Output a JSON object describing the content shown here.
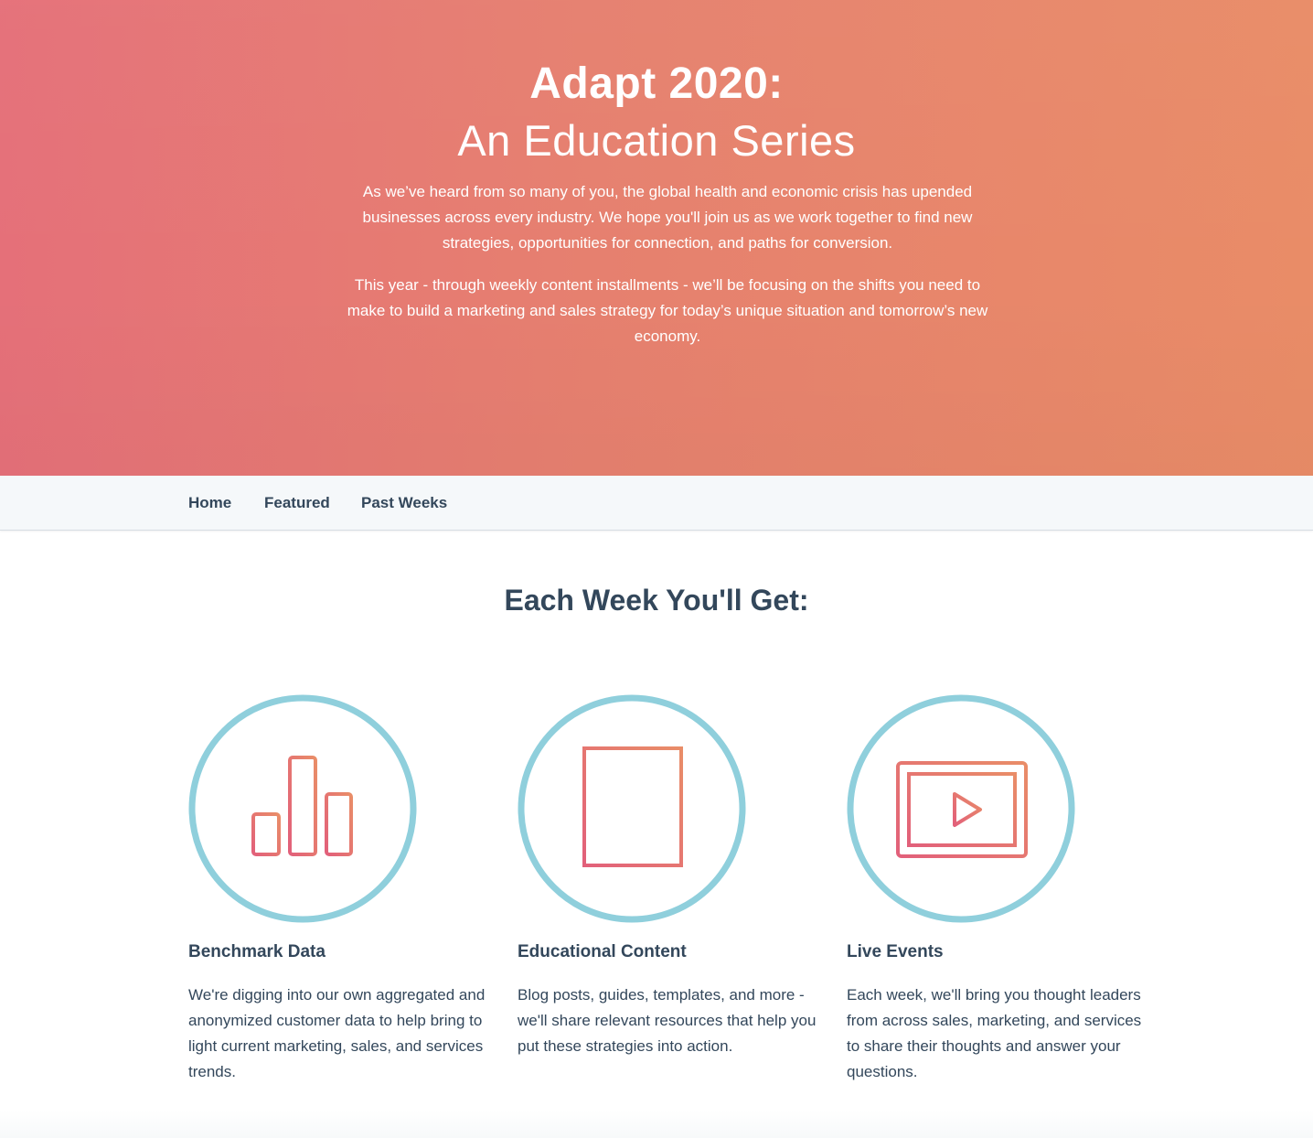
{
  "hero": {
    "title": "Adapt 2020:",
    "subtitle": "An Education Series",
    "paragraph_1": "As we’ve heard from so many of you, the global health and economic crisis has upended businesses across every industry. We hope you'll join us as we work together to find new strategies, opportunities for connection, and paths for conversion.",
    "paragraph_2": "This year - through weekly content installments - we’ll be focusing on the shifts you need to make to build a marketing and sales strategy for today’s unique situation and tomorrow’s new economy.",
    "gradient_start": "#e57079",
    "gradient_end": "#e98c67"
  },
  "nav": {
    "items": [
      {
        "label": "Home"
      },
      {
        "label": "Featured"
      },
      {
        "label": "Past Weeks"
      }
    ]
  },
  "section": {
    "title": "Each Week You'll Get:"
  },
  "features": [
    {
      "icon": "bar-chart-icon",
      "title": "Benchmark Data",
      "description": "We're digging into our own aggregated and anonymized customer data to help bring to light current marketing, sales, and services trends."
    },
    {
      "icon": "document-icon",
      "title": "Educational Content",
      "description": "Blog posts, guides, templates, and more - we'll share relevant resources that help you put these strategies into action."
    },
    {
      "icon": "video-play-icon",
      "title": "Live Events",
      "description": "Each week, we'll bring you thought leaders from across sales, marketing, and services to share their thoughts and answer your questions."
    }
  ],
  "colors": {
    "circle": "#8fcfdc",
    "icon_gradient_start": "#e2607a",
    "icon_gradient_end": "#e98d68",
    "text": "#33475b",
    "nav_bg": "#f5f8fa"
  }
}
